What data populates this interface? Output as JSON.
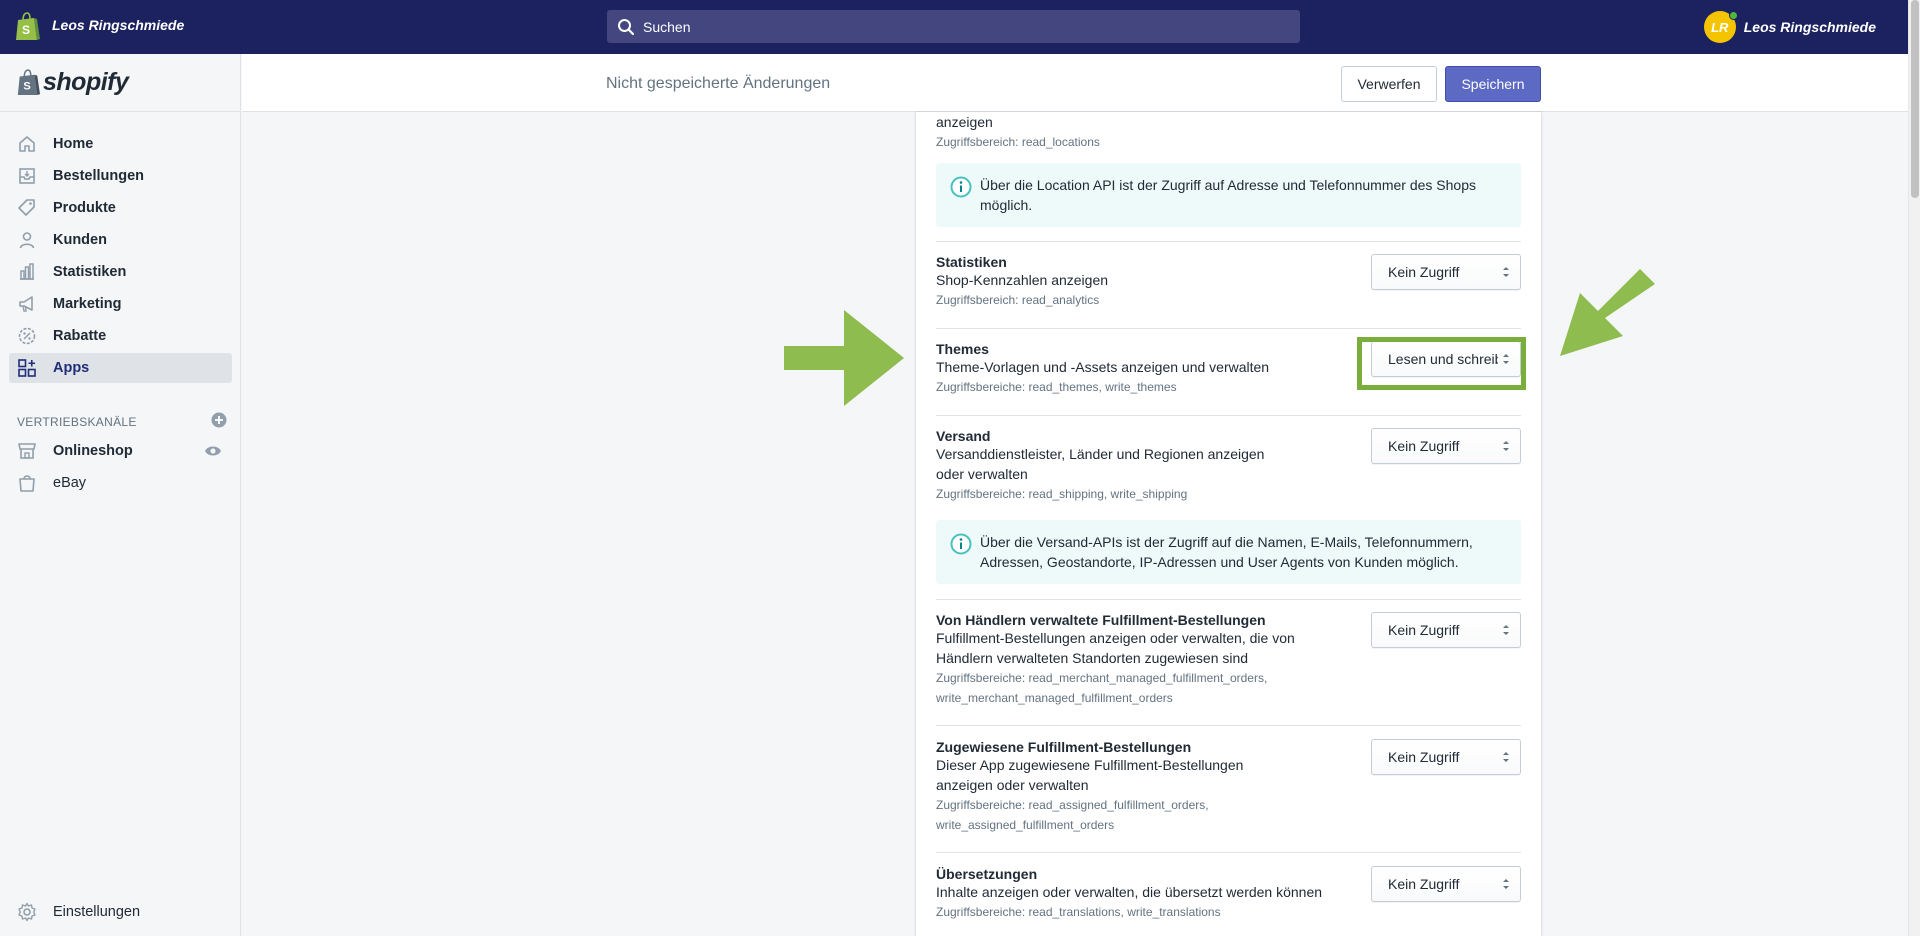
{
  "topbar": {
    "shop_name": "Leos Ringschmiede",
    "search_placeholder": "Suchen",
    "user_initials": "LR",
    "user_name": "Leos Ringschmiede"
  },
  "sidebar": {
    "logo_text": "shopify",
    "items": [
      {
        "label": "Home",
        "icon": "home-icon"
      },
      {
        "label": "Bestellungen",
        "icon": "orders-icon"
      },
      {
        "label": "Produkte",
        "icon": "tag-icon"
      },
      {
        "label": "Kunden",
        "icon": "person-icon"
      },
      {
        "label": "Statistiken",
        "icon": "bar-chart-icon"
      },
      {
        "label": "Marketing",
        "icon": "megaphone-icon"
      },
      {
        "label": "Rabatte",
        "icon": "discount-icon"
      },
      {
        "label": "Apps",
        "icon": "apps-icon",
        "active": true
      }
    ],
    "channels_header": "VERTRIEBSKANÄLE",
    "channels": [
      {
        "label": "Onlineshop",
        "icon": "store-icon"
      },
      {
        "label": "eBay",
        "icon": "bag-icon"
      }
    ],
    "settings_label": "Einstellungen"
  },
  "savebar": {
    "message": "Nicht gespeicherte Änderungen",
    "discard_label": "Verwerfen",
    "save_label": "Speichern"
  },
  "permissions": {
    "locations": {
      "desc_tail": "anzeigen",
      "scope": "Zugriffsbereich: read_locations",
      "info": "Über die Location API ist der Zugriff auf Adresse und Telefonnummer des Shops möglich."
    },
    "analytics": {
      "title": "Statistiken",
      "desc": "Shop-Kennzahlen anzeigen",
      "scope": "Zugriffsbereich: read_analytics",
      "select": "Kein Zugriff"
    },
    "themes": {
      "title": "Themes",
      "desc": "Theme-Vorlagen und -Assets anzeigen und verwalten",
      "scope": "Zugriffsbereiche: read_themes, write_themes",
      "select": "Lesen und schreiben"
    },
    "shipping": {
      "title": "Versand",
      "desc": "Versanddienstleister, Länder und Regionen anzeigen oder verwalten",
      "scope": "Zugriffsbereiche: read_shipping, write_shipping",
      "select": "Kein Zugriff",
      "info": "Über die Versand-APIs ist der Zugriff auf die Namen, E-Mails, Telefonnummern, Adressen, Geostandorte, IP-Adressen und User Agents von Kunden möglich."
    },
    "merchant_fulfillment": {
      "title": "Von Händlern verwaltete Fulfillment-Bestellungen",
      "desc": "Fulfillment-Bestellungen anzeigen oder verwalten, die von Händlern verwalteten Standorten zugewiesen sind",
      "scope": "Zugriffsbereiche: read_merchant_managed_fulfillment_orders, write_merchant_managed_fulfillment_orders",
      "select": "Kein Zugriff"
    },
    "assigned_fulfillment": {
      "title": "Zugewiesene Fulfillment-Bestellungen",
      "desc": "Dieser App zugewiesene Fulfillment-Bestellungen anzeigen oder verwalten",
      "scope": "Zugriffsbereiche: read_assigned_fulfillment_orders, write_assigned_fulfillment_orders",
      "select": "Kein Zugriff"
    },
    "translations": {
      "title": "Übersetzungen",
      "desc": "Inhalte anzeigen oder verwalten, die übersetzt werden können",
      "scope": "Zugriffsbereiche: read_translations, write_translations",
      "select": "Kein Zugriff"
    }
  },
  "colors": {
    "topbar": "#1c2260",
    "primary": "#5c6ac4",
    "highlight": "#79ae3d"
  }
}
